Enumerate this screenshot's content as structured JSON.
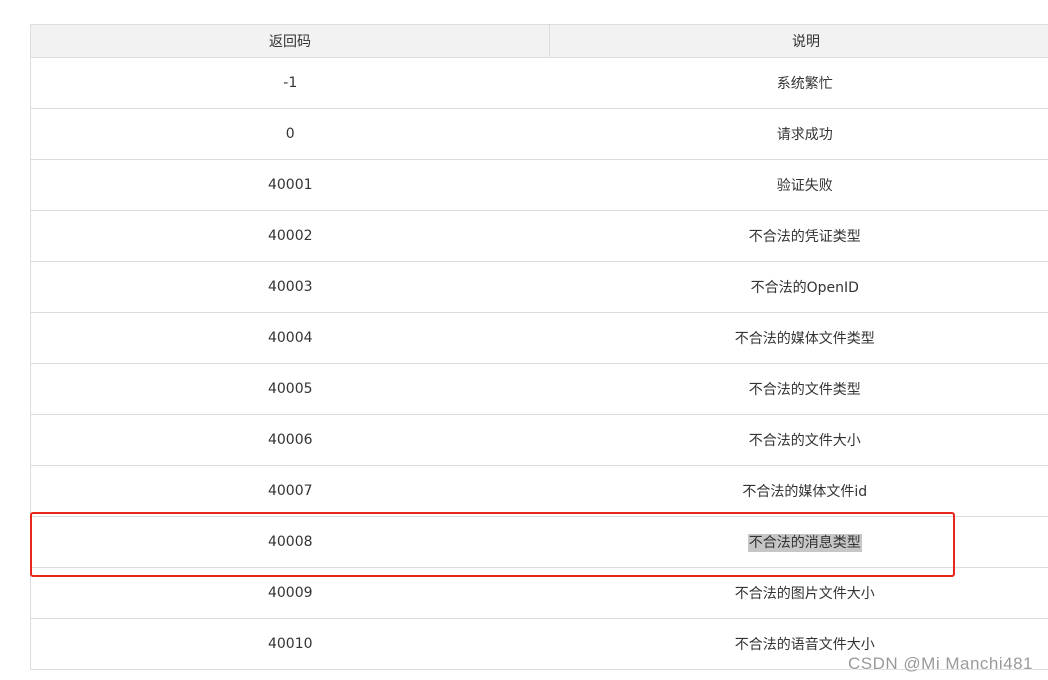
{
  "table": {
    "headers": {
      "code": "返回码",
      "description": "说明"
    },
    "rows": [
      {
        "code": "-1",
        "description": "系统繁忙"
      },
      {
        "code": "0",
        "description": "请求成功"
      },
      {
        "code": "40001",
        "description": "验证失败"
      },
      {
        "code": "40002",
        "description": "不合法的凭证类型"
      },
      {
        "code": "40003",
        "description": "不合法的OpenID"
      },
      {
        "code": "40004",
        "description": "不合法的媒体文件类型"
      },
      {
        "code": "40005",
        "description": "不合法的文件类型"
      },
      {
        "code": "40006",
        "description": "不合法的文件大小"
      },
      {
        "code": "40007",
        "description": "不合法的媒体文件id"
      },
      {
        "code": "40008",
        "description": "不合法的消息类型",
        "highlighted": true
      },
      {
        "code": "40009",
        "description": "不合法的图片文件大小"
      },
      {
        "code": "40010",
        "description": "不合法的语音文件大小"
      }
    ]
  },
  "annotation": {
    "color": "#e8271c"
  },
  "watermark": {
    "text": "CSDN @Mi   Manchi481"
  }
}
